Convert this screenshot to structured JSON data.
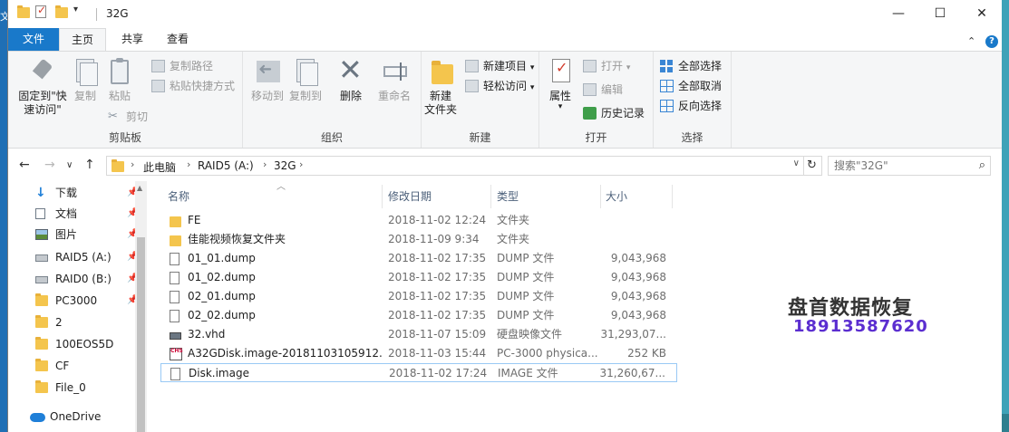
{
  "window": {
    "title": "32G",
    "controls": {
      "minimize": "—",
      "maximize": "☐",
      "close": "✕"
    }
  },
  "desktop_glyph": "文",
  "ribbon_tabs": [
    "文件",
    "主页",
    "共享",
    "查看"
  ],
  "ribbon": {
    "clipboard": {
      "label": "剪贴板",
      "pin_line1": "固定到\"快",
      "pin_line2": "速访问\"",
      "copy": "复制",
      "paste": "粘贴",
      "copy_path": "复制路径",
      "paste_shortcut": "粘贴快捷方式",
      "cut": "剪切"
    },
    "organize": {
      "label": "组织",
      "move_to": "移动到",
      "copy_to": "复制到",
      "delete": "删除",
      "rename": "重命名"
    },
    "new": {
      "label": "新建",
      "new_folder_line1": "新建",
      "new_folder_line2": "文件夹",
      "new_item": "新建项目",
      "easy_access": "轻松访问"
    },
    "open": {
      "label": "打开",
      "properties": "属性",
      "open": "打开",
      "edit": "编辑",
      "history": "历史记录"
    },
    "select": {
      "label": "选择",
      "select_all": "全部选择",
      "select_none": "全部取消",
      "invert": "反向选择"
    }
  },
  "address": {
    "crumbs": [
      "此电脑",
      "RAID5 (A:)",
      "32G"
    ]
  },
  "search": {
    "placeholder": "搜索\"32G\""
  },
  "nav_pane": [
    {
      "label": "下载",
      "icon": "download-icon",
      "pinned": true
    },
    {
      "label": "文档",
      "icon": "document-icon",
      "pinned": true
    },
    {
      "label": "图片",
      "icon": "pictures-icon",
      "pinned": true
    },
    {
      "label": "RAID5 (A:)",
      "icon": "drive-icon",
      "pinned": true
    },
    {
      "label": "RAID0 (B:)",
      "icon": "drive-icon",
      "pinned": true
    },
    {
      "label": "PC3000",
      "icon": "folder-icon",
      "pinned": true
    },
    {
      "label": "2",
      "icon": "folder-icon",
      "pinned": false
    },
    {
      "label": "100EOS5D",
      "icon": "folder-icon",
      "pinned": false
    },
    {
      "label": "CF",
      "icon": "folder-icon",
      "pinned": false
    },
    {
      "label": "File_0",
      "icon": "folder-icon",
      "pinned": false
    },
    {
      "label": "OneDrive",
      "icon": "cloud-icon",
      "pinned": false
    }
  ],
  "columns": {
    "name": "名称",
    "date": "修改日期",
    "type": "类型",
    "size": "大小"
  },
  "files": [
    {
      "name": "FE",
      "date": "2018-11-02 12:24",
      "type": "文件夹",
      "size": "",
      "icon": "folder-icon"
    },
    {
      "name": "佳能视频恢复文件夹",
      "date": "2018-11-09 9:34",
      "type": "文件夹",
      "size": "",
      "icon": "folder-icon"
    },
    {
      "name": "01_01.dump",
      "date": "2018-11-02 17:35",
      "type": "DUMP 文件",
      "size": "9,043,968",
      "icon": "file-icon"
    },
    {
      "name": "01_02.dump",
      "date": "2018-11-02 17:35",
      "type": "DUMP 文件",
      "size": "9,043,968",
      "icon": "file-icon"
    },
    {
      "name": "02_01.dump",
      "date": "2018-11-02 17:35",
      "type": "DUMP 文件",
      "size": "9,043,968",
      "icon": "file-icon"
    },
    {
      "name": "02_02.dump",
      "date": "2018-11-02 17:35",
      "type": "DUMP 文件",
      "size": "9,043,968",
      "icon": "file-icon"
    },
    {
      "name": "32.vhd",
      "date": "2018-11-07 15:09",
      "type": "硬盘映像文件",
      "size": "31,293,07...",
      "icon": "vhd-icon"
    },
    {
      "name": "A32GDisk.image-20181103105912...",
      "date": "2018-11-03 15:44",
      "type": "PC-3000 physica...",
      "size": "252 KB",
      "icon": "chs-icon"
    },
    {
      "name": "Disk.image",
      "date": "2018-11-02 17:24",
      "type": "IMAGE 文件",
      "size": "31,260,67...",
      "icon": "file-icon",
      "selected": true
    }
  ],
  "watermark": {
    "line1": "盘首数据恢复",
    "line2": "18913587620"
  }
}
